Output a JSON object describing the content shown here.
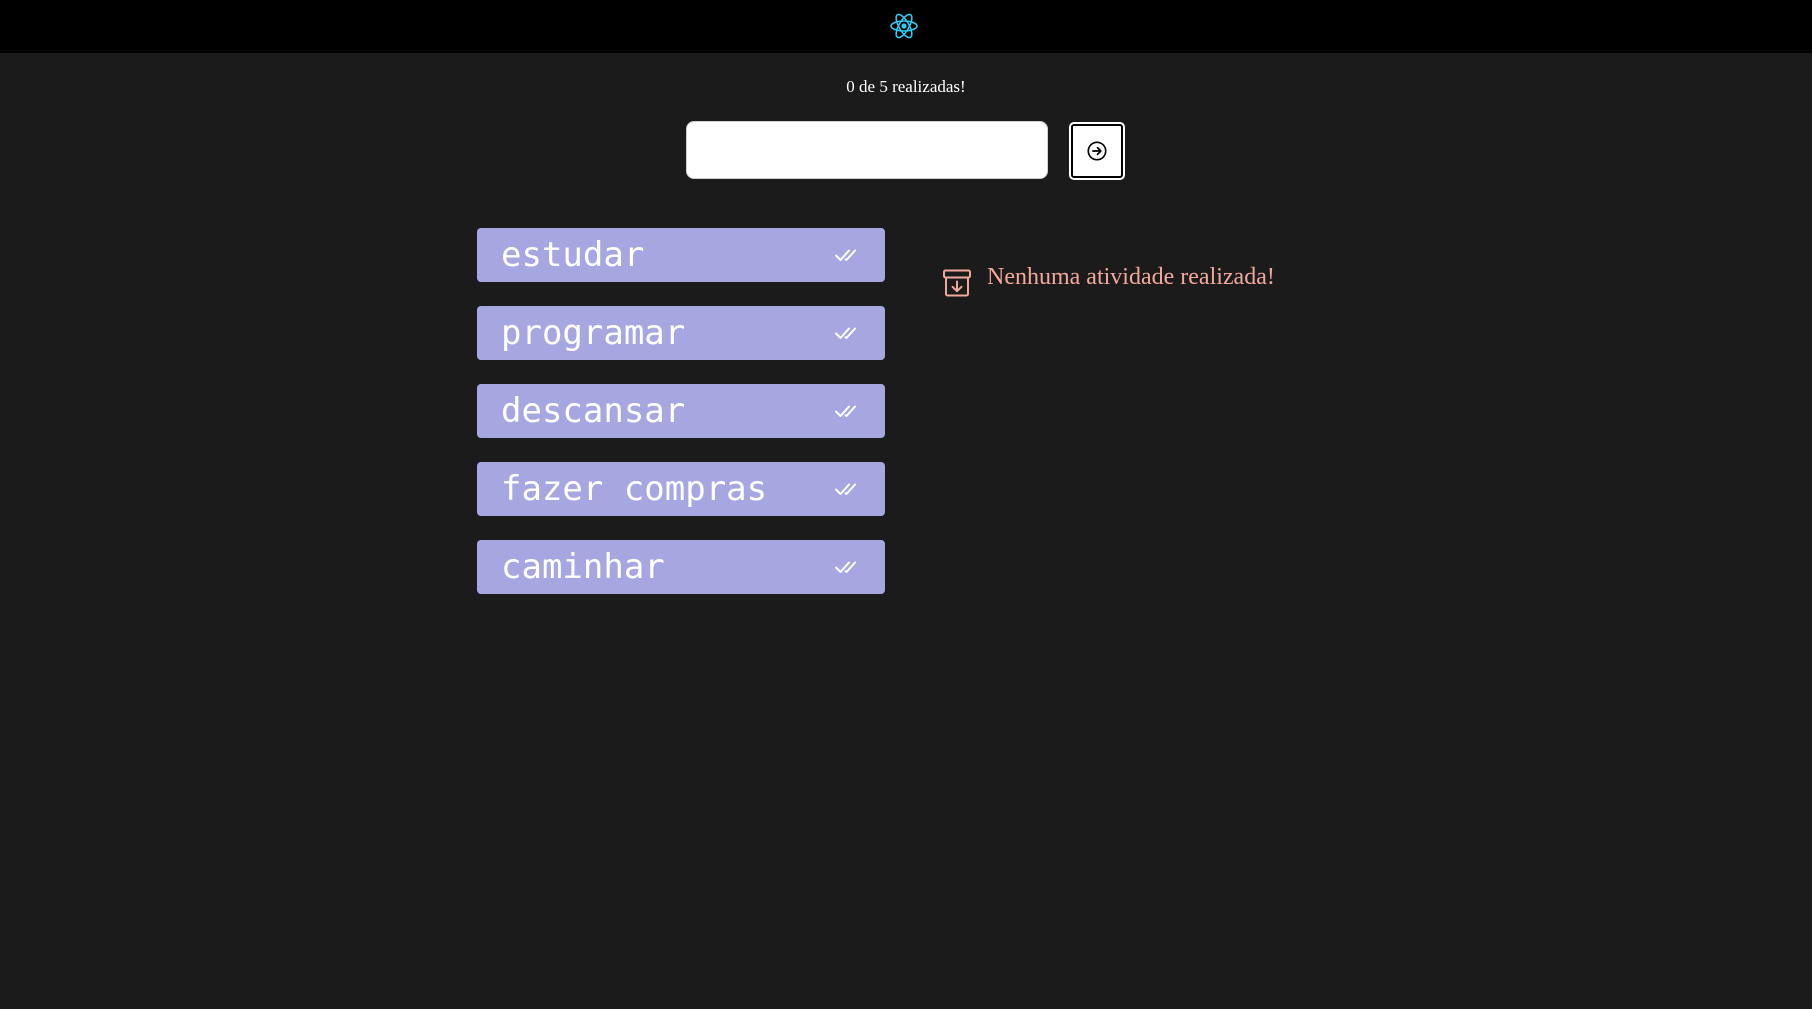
{
  "header": {
    "logo_icon": "react-logo-icon",
    "logo_color": "#2ec9ee"
  },
  "counter": {
    "text": "0 de 5 realizadas!"
  },
  "task_input": {
    "value": "",
    "placeholder": ""
  },
  "submit_button": {
    "icon": "arrow-right-circle-icon"
  },
  "tasks": {
    "items": [
      {
        "label": "estudar",
        "icon": "double-check-icon"
      },
      {
        "label": "programar",
        "icon": "double-check-icon"
      },
      {
        "label": "descansar",
        "icon": "double-check-icon"
      },
      {
        "label": "fazer compras",
        "icon": "double-check-icon"
      },
      {
        "label": "caminhar",
        "icon": "double-check-icon"
      }
    ]
  },
  "done": {
    "icon": "archive-download-icon",
    "empty_message": "Nenhuma atividade realizada!"
  },
  "colors": {
    "background": "#1b1b1b",
    "header": "#000000",
    "task_item": "#a6a6e1",
    "empty_message": "#f2a99c"
  }
}
